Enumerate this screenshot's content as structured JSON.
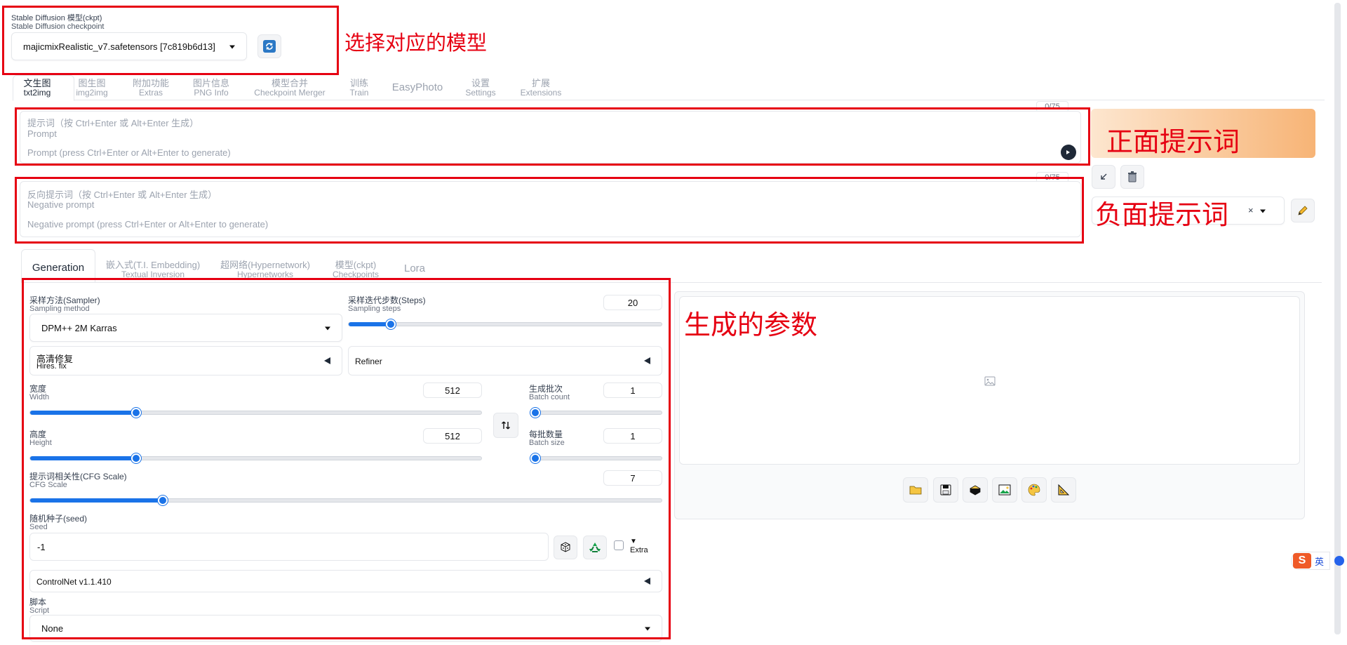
{
  "checkpoint": {
    "label_cn": "Stable Diffusion 模型(ckpt)",
    "label_en": "Stable Diffusion checkpoint",
    "value": "majicmixRealistic_v7.safetensors [7c819b6d13]"
  },
  "annotations": {
    "model": "选择对应的模型",
    "positive": "正面提示词",
    "negative": "负面提示词",
    "params": "生成的参数"
  },
  "top_tabs": [
    {
      "cn": "文生图",
      "en": "txt2img"
    },
    {
      "cn": "图生图",
      "en": "img2img"
    },
    {
      "cn": "附加功能",
      "en": "Extras"
    },
    {
      "cn": "图片信息",
      "en": "PNG Info"
    },
    {
      "cn": "模型合并",
      "en": "Checkpoint Merger"
    },
    {
      "cn": "训练",
      "en": "Train"
    },
    {
      "cn": "EasyPhoto",
      "en": ""
    },
    {
      "cn": "设置",
      "en": "Settings"
    },
    {
      "cn": "扩展",
      "en": "Extensions"
    }
  ],
  "prompt": {
    "hint_cn": "提示词（按 Ctrl+Enter 或 Alt+Enter 生成）",
    "hint_en": "Prompt",
    "placeholder": "Prompt (press Ctrl+Enter or Alt+Enter to generate)",
    "counter": "0/75"
  },
  "negative": {
    "hint_cn": "反向提示词（按 Ctrl+Enter 或 Alt+Enter 生成）",
    "hint_en": "Negative prompt",
    "placeholder": "Negative prompt (press Ctrl+Enter or Alt+Enter to generate)",
    "counter": "0/75"
  },
  "sub_tabs": [
    {
      "cn": "Generation",
      "en": ""
    },
    {
      "cn": "嵌入式(T.I. Embedding)",
      "en": "Textual Inversion"
    },
    {
      "cn": "超网络(Hypernetwork)",
      "en": "Hypernetworks"
    },
    {
      "cn": "模型(ckpt)",
      "en": "Checkpoints"
    },
    {
      "cn": "Lora",
      "en": ""
    }
  ],
  "sampler": {
    "label_cn": "采样方法(Sampler)",
    "label_en": "Sampling method",
    "value": "DPM++ 2M Karras"
  },
  "steps": {
    "label_cn": "采样迭代步数(Steps)",
    "label_en": "Sampling steps",
    "value": "20",
    "fraction": 0.135
  },
  "hires": {
    "label_cn": "高清修复",
    "label_en": "Hires. fix"
  },
  "refiner": {
    "label": "Refiner"
  },
  "width": {
    "label_cn": "宽度",
    "label_en": "Width",
    "value": "512",
    "fraction": 0.235
  },
  "height": {
    "label_cn": "高度",
    "label_en": "Height",
    "value": "512",
    "fraction": 0.235
  },
  "batch_count": {
    "label_cn": "生成批次",
    "label_en": "Batch count",
    "value": "1",
    "fraction": 0.0
  },
  "batch_size": {
    "label_cn": "每批数量",
    "label_en": "Batch size",
    "value": "1",
    "fraction": 0.0
  },
  "cfg": {
    "label_cn": "提示词相关性(CFG Scale)",
    "label_en": "CFG Scale",
    "value": "7",
    "fraction": 0.21
  },
  "seed": {
    "label_cn": "随机种子(seed)",
    "label_en": "Seed",
    "value": "-1",
    "extra": "Extra"
  },
  "controlnet": {
    "label": "ControlNet v1.1.410"
  },
  "script": {
    "label_cn": "脚本",
    "label_en": "Script",
    "value": "None"
  },
  "ime": {
    "text": "英"
  },
  "colors": {
    "accent": "#1a73e8",
    "annotation": "#e60012",
    "generate": "#f59e42"
  }
}
